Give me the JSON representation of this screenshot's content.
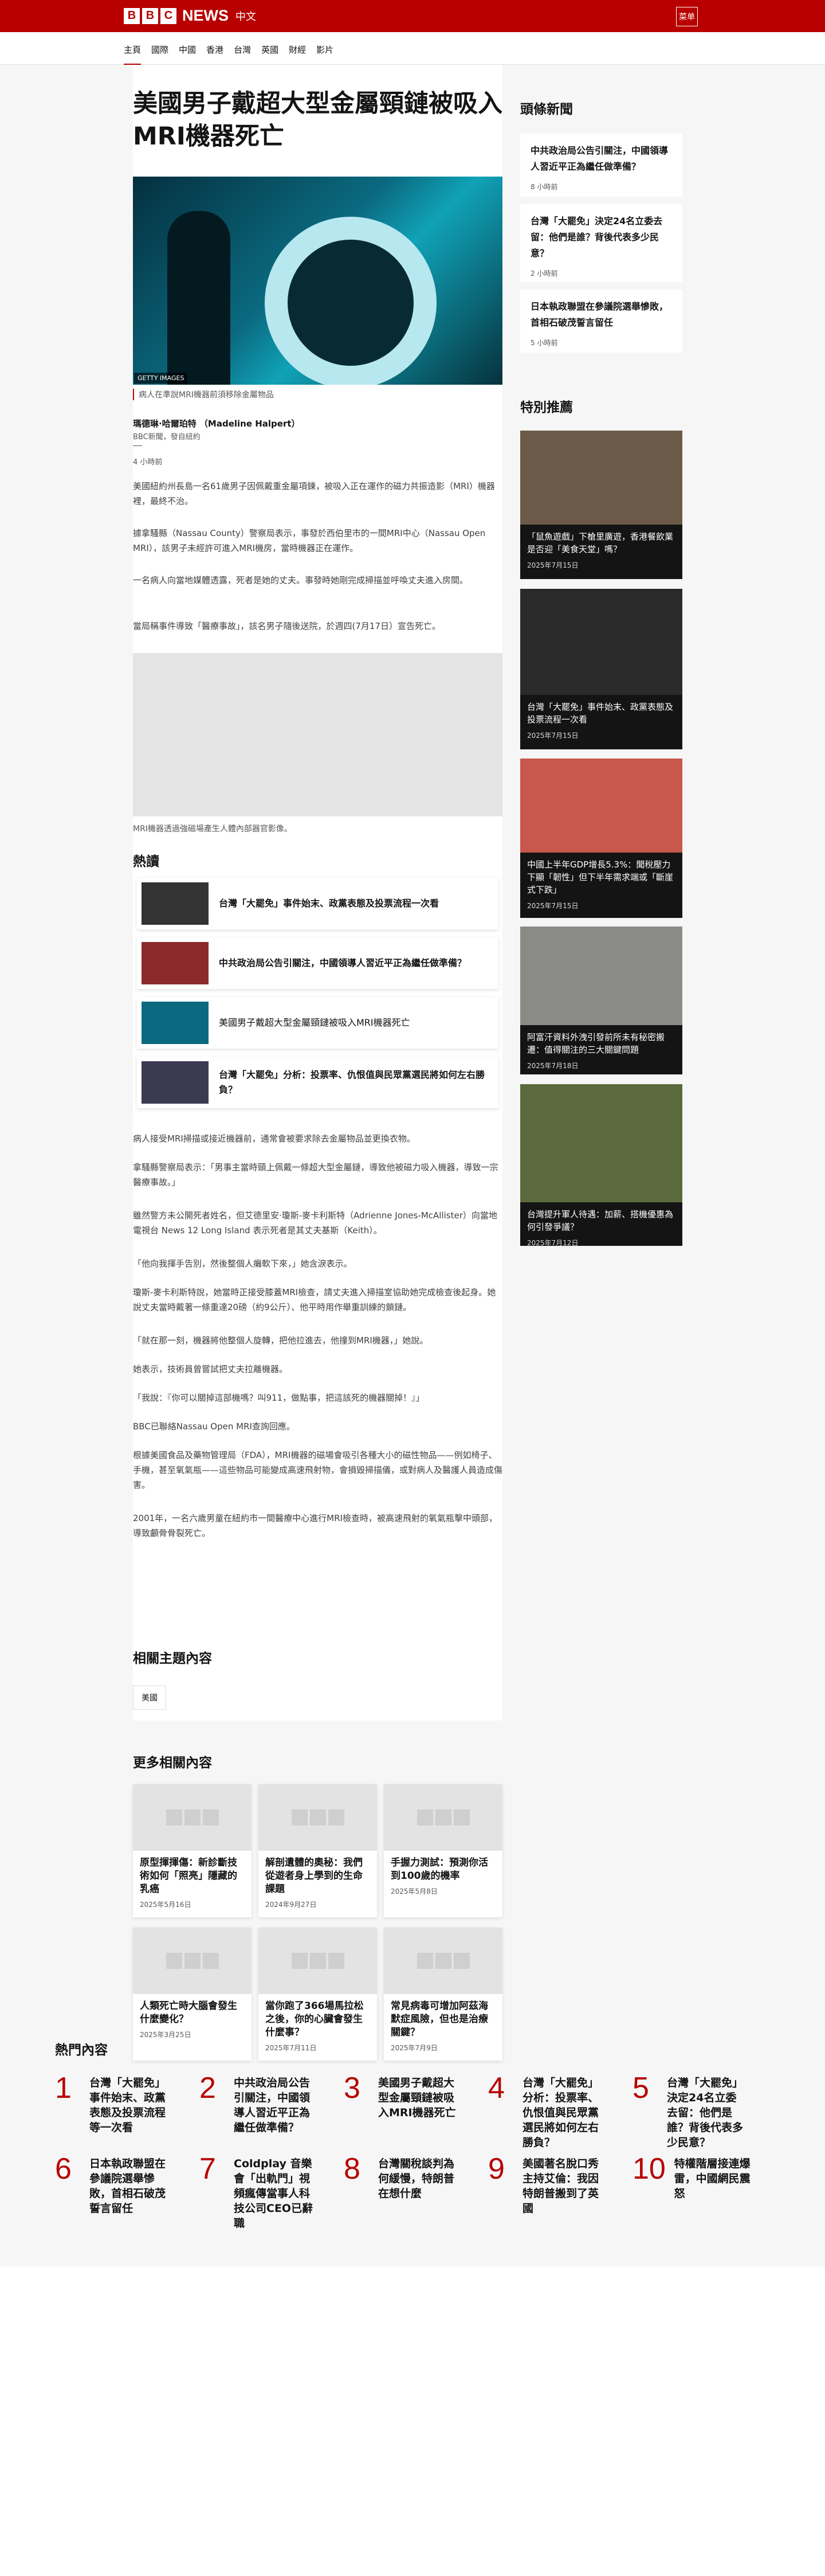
{
  "masthead": {
    "logo_letters": [
      "B",
      "B",
      "C"
    ],
    "brand": "NEWS",
    "language": "中文",
    "menu_button": "菜单"
  },
  "nav": [
    "主頁",
    "國際",
    "中國",
    "香港",
    "台灣",
    "英國",
    "財經",
    "影片"
  ],
  "article": {
    "title": "美國男子戴超大型金屬頸鏈被吸入MRI機器死亡",
    "image_credit": "GETTY IMAGES",
    "image_caption": "病人在準說MRI機器前須移除金屬物品",
    "author": "瑪德琳·哈爾珀特 （Madeline Halpert）",
    "org": "BBC新聞，發自紐約",
    "time": "4 小時前",
    "paragraphs_top": [
      "美國紐約州長島一名61歲男子因佩戴重金屬項鍊，被吸入正在運作的磁力共振造影（MRI）機器裡，最終不治。",
      "據拿騷縣（Nassau County）警察局表示，事發於西伯里市的一間MRI中心（Nassau Open MRI），該男子未經許可進入MRI機房，當時機器正在運作。",
      "一名病人向當地媒體透露，死者是她的丈夫。事發時她剛完成掃描並呼喚丈夫進入房間。",
      "當局稱事件導致「醫療事故」，該名男子隨後送院，於週四(7月17日）宣告死亡。"
    ],
    "video_caption": "MRI機器透過強磁場產生人體內部器官影像。",
    "paragraphs_bottom": [
      "病人接受MRI掃描或接近機器前，通常會被要求除去金屬物品並更換衣物。",
      "拿騷縣警察局表示：「男事主當時頸上佩戴一條超大型金屬鏈，導致他被磁力吸入機器，導致一宗醫療事故。」",
      "雖然警方未公開死者姓名，但艾德里安·瓊斯-麥卡利斯特（Adrienne Jones-McAllister）向當地電視台 News 12 Long Island 表示死者是其丈夫基斯（Keith）。",
      "「他向我揮手告別，然後整個人癱軟下來，」她含淚表示。",
      "瓊斯-麥卡利斯特說，她當時正接受膝蓋MRI檢查，請丈夫進入掃描室協助她完成檢查後起身。她說丈夫當時戴著一條重達20磅（約9公斤）、他平時用作舉重訓練的鎖鏈。",
      "「就在那一刻，機器將他整個人旋轉，把他拉進去，他撞到MRI機器，」她說。",
      "她表示，技術員曾嘗試把丈夫拉離機器。",
      "「我說：『你可以關掉這部機嗎？叫911，做點事，把這該死的機器關掉！』」",
      "BBC已聯絡Nassau Open MRI查詢回應。",
      "根據美國食品及藥物管理局（FDA），MRI機器的磁場會吸引各種大小的磁性物品——例如椅子、手機，甚至氧氣瓶——這些物品可能變成高速飛射物，會損毀掃描儀，或對病人及醫護人員造成傷害。",
      "2001年，一名六歲男童在紐約市一間醫療中心進行MRI檢查時，被高速飛射的氧氣瓶擊中頭部，導致顱骨骨裂死亡。"
    ],
    "hot_title": "熱讀",
    "hot_items": [
      "台灣「大罷免」事件始末、政黨表態及投票流程一次看",
      "中共政治局公告引關注，中國領導人習近平正為繼任做準備？",
      "美國男子戴超大型金屬頸鏈被吸入MRI機器死亡",
      "台灣「大罷免」分析：投票率、仇恨值與民眾黨選民將如何左右勝負？"
    ],
    "topics_title": "相關主題內容",
    "topic_tag": "美國",
    "related_title": "更多相關內容",
    "related": [
      {
        "title": "原型揮揮傷：新診斷技術如何「照亮」隱藏的乳癌",
        "date": "2025年5月16日"
      },
      {
        "title": "解剖遺體的奧秘：我們從遊者身上學到的生命課題",
        "date": "2024年9月27日"
      },
      {
        "title": "手握力測試：預測你活到100歲的機率",
        "date": "2025年5月8日"
      },
      {
        "title": "人類死亡時大腦會發生什麼變化？",
        "date": "2025年3月25日"
      },
      {
        "title": "當你跑了366場馬拉松之後，你的心臟會發生什麼事？",
        "date": "2025年7月11日"
      },
      {
        "title": "常見病毒可增加阿茲海默症風險，但也是治療關鍵？",
        "date": "2025年7月9日"
      }
    ]
  },
  "sidebar": {
    "latest_title": "頭條新聞",
    "latest": [
      {
        "title": "中共政治局公告引關注，中國領導人習近平正為繼任做準備？",
        "time": "8 小時前"
      },
      {
        "title": "台灣「大罷免」決定24名立委去留：他們是誰？背後代表多少民意？",
        "time": "2 小時前"
      },
      {
        "title": "日本執政聯盟在參議院選舉慘敗，首相石破茂誓言留任",
        "time": "5 小時前"
      }
    ],
    "picks_title": "特別推薦",
    "picks": [
      {
        "title": "「鼠魚遊戲」下槍里廣遊，香港餐飲業是否迎「美食天堂」嗎？",
        "date": "2025年7月15日"
      },
      {
        "title": "台灣「大罷免」事件始末、政黨表態及投票流程一次看",
        "date": "2025年7月15日"
      },
      {
        "title": "中國上半年GDP增長5.3%：聞稅壓力下顯「韌性」但下半年需求端或「斷崖式下跌」",
        "date": "2025年7月15日"
      },
      {
        "title": "阿富汗資料外洩引發前所未有秘密搬遷：值得關注的三大關鍵問題",
        "date": "2025年7月18日"
      },
      {
        "title": "台灣提升軍人待遇：加薪、搭機優惠為何引發爭議？",
        "date": "2025年7月12日"
      }
    ]
  },
  "most_read": {
    "title": "熱門內容",
    "items": [
      {
        "n": "1",
        "title": "台灣「大罷免」事件始末、政黨表態及投票流程等一次看"
      },
      {
        "n": "2",
        "title": "中共政治局公告引關注，中國領導人習近平正為繼任做準備？"
      },
      {
        "n": "3",
        "title": "美國男子戴超大型金屬頸鏈被吸入MRI機器死亡"
      },
      {
        "n": "4",
        "title": "台灣「大罷免」分析：投票率、仇恨值與民眾黨選民將如何左右勝負？"
      },
      {
        "n": "5",
        "title": "台灣「大罷免」決定24名立委去留：他們是誰？背後代表多少民意？"
      },
      {
        "n": "6",
        "title": "日本執政聯盟在參議院選舉慘敗，首相石破茂誓言留任"
      },
      {
        "n": "7",
        "title": "Coldplay 音樂會「出軌門」視頻瘋傳當事人科技公司CEO已辭職"
      },
      {
        "n": "8",
        "title": "台灣關稅談判為何緩慢，特朗普在想什麼"
      },
      {
        "n": "9",
        "title": "美國著名脫口秀主持艾倫：我因特朗普搬到了英國"
      },
      {
        "n": "10",
        "title": "特權階層接連爆雷，中國網民震怒"
      }
    ]
  }
}
